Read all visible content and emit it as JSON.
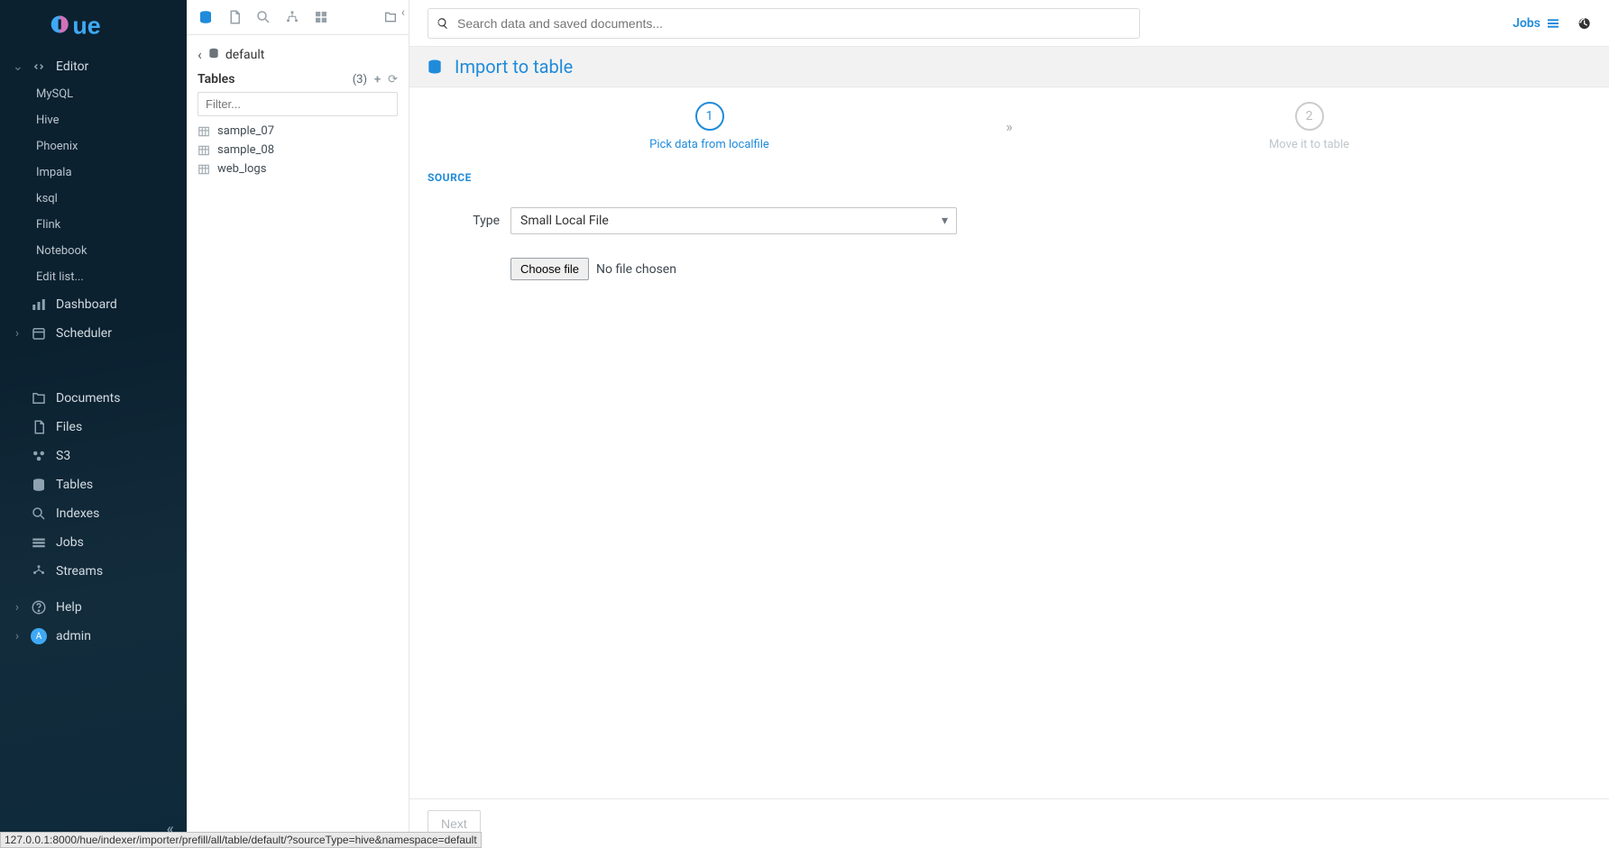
{
  "brand": {
    "name": "Hue"
  },
  "search": {
    "placeholder": "Search data and saved documents..."
  },
  "topbar": {
    "jobs_label": "Jobs"
  },
  "sidebar": {
    "editor": {
      "label": "Editor",
      "items": [
        {
          "label": "MySQL"
        },
        {
          "label": "Hive"
        },
        {
          "label": "Phoenix"
        },
        {
          "label": "Impala"
        },
        {
          "label": "ksql"
        },
        {
          "label": "Flink"
        },
        {
          "label": "Notebook"
        },
        {
          "label": "Edit list..."
        }
      ]
    },
    "dashboard_label": "Dashboard",
    "scheduler_label": "Scheduler",
    "documents_label": "Documents",
    "files_label": "Files",
    "s3_label": "S3",
    "tables_label": "Tables",
    "indexes_label": "Indexes",
    "jobs_label": "Jobs",
    "streams_label": "Streams",
    "help_label": "Help",
    "admin_label": "admin",
    "admin_initial": "A"
  },
  "assist": {
    "breadcrumb": "default",
    "section_label": "Tables",
    "count": "(3)",
    "filter_placeholder": "Filter...",
    "tables": [
      {
        "name": "sample_07"
      },
      {
        "name": "sample_08"
      },
      {
        "name": "web_logs"
      }
    ]
  },
  "page": {
    "title": "Import to table",
    "wizard": {
      "step1": {
        "num": "1",
        "label": "Pick data from localfile"
      },
      "step2": {
        "num": "2",
        "label": "Move it to table"
      }
    },
    "section_source": "SOURCE",
    "type_label": "Type",
    "type_value": "Small Local File",
    "choose_file_label": "Choose file",
    "no_file_label": "No file chosen",
    "next_label": "Next"
  },
  "status_bar": "127.0.0.1:8000/hue/indexer/importer/prefill/all/table/default/?sourceType=hive&namespace=default"
}
